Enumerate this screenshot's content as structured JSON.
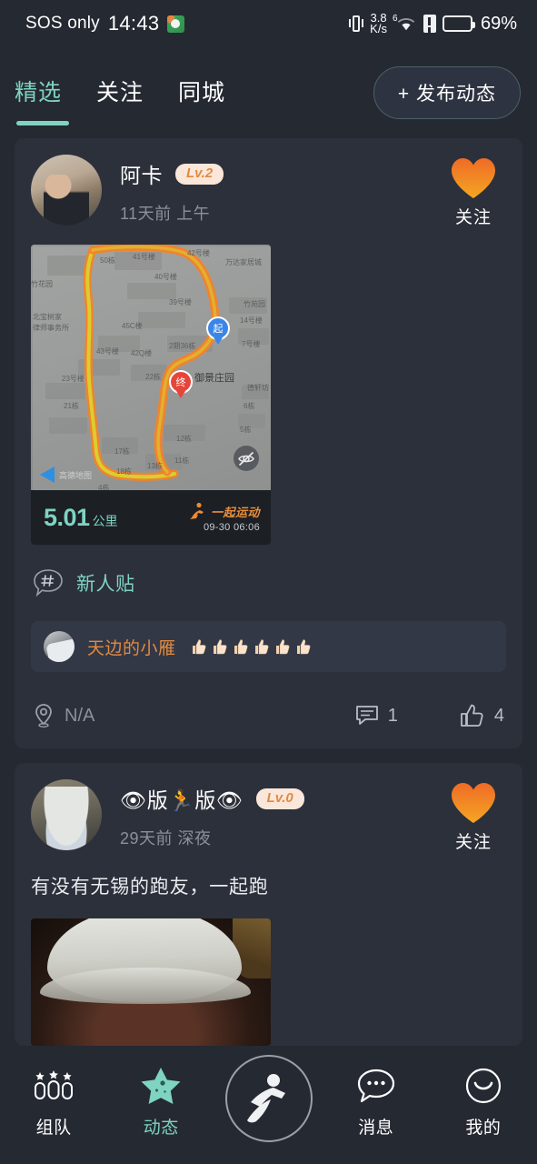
{
  "status_bar": {
    "carrier": "SOS only",
    "time": "14:43",
    "app_icon": "weather-icon",
    "vibrate_icon": "vibrate-icon",
    "net_speed": "3.8",
    "net_speed_unit": "K/s",
    "wifi_icon": "wifi-icon",
    "wifi_gen": "6",
    "sim_icon": "sim-alert-icon",
    "battery_icon": "battery-icon",
    "battery_pct": "69%"
  },
  "header": {
    "tabs": [
      {
        "label": "精选",
        "active": true
      },
      {
        "label": "关注",
        "active": false
      },
      {
        "label": "同城",
        "active": false
      }
    ],
    "publish_button": "+ 发布动态",
    "accent_color": "#7ed3c2"
  },
  "posts": [
    {
      "user": "阿卡",
      "level": "Lv.2",
      "timestamp": "11天前 上午",
      "follow_label": "关注",
      "follow_icon": "heart-icon",
      "follow_color": "#f08a2a",
      "map": {
        "distance_value": "5.01",
        "distance_unit": "公里",
        "brand": "一起运动",
        "brand_time": "09-30 06:06",
        "hide_icon": "eye-off-icon",
        "provider": "高德地图",
        "start_marker": "起",
        "end_marker": "终",
        "labels": [
          "50栋",
          "41号楼",
          "42号楼",
          "万达家居城",
          "40号楼",
          "39号楼",
          "竹苑园",
          "14号楼",
          "45C楼",
          "2期36栋",
          "7号楼",
          "43号楼",
          "42Q楼",
          "23号楼",
          "22栋",
          "御景庄园",
          "德轩坊",
          "21栋",
          "6栋",
          "5栋",
          "12栋",
          "17栋",
          "11栋",
          "13栋",
          "18栋",
          "4栋",
          "北宝树家",
          "律师事务所",
          "竹花园"
        ]
      },
      "topic": {
        "icon": "hash-bubble-icon",
        "label": "新人贴"
      },
      "comment": {
        "user": "天边的小雁",
        "emoji": "👍",
        "emoji_count": 6
      },
      "location_icon": "location-pin-icon",
      "location": "N/A",
      "comment_icon": "comment-icon",
      "comment_count": "1",
      "like_icon": "thumbs-up-icon",
      "like_count": "4"
    },
    {
      "user": "👁版🏃版👁",
      "user_plain": "版版",
      "level": "Lv.0",
      "timestamp": "29天前 深夜",
      "follow_label": "关注",
      "follow_icon": "heart-icon",
      "follow_color": "#f08a2a",
      "text": "有没有无锡的跑友，一起跑"
    }
  ],
  "bottom_nav": [
    {
      "label": "组队",
      "icon": "team-medals-icon",
      "active": false
    },
    {
      "label": "动态",
      "icon": "star-icon",
      "active": true
    },
    {
      "label": "",
      "icon": "runner-icon",
      "active": false
    },
    {
      "label": "消息",
      "icon": "message-bubble-icon",
      "active": false
    },
    {
      "label": "我的",
      "icon": "smiley-face-icon",
      "active": false
    }
  ]
}
